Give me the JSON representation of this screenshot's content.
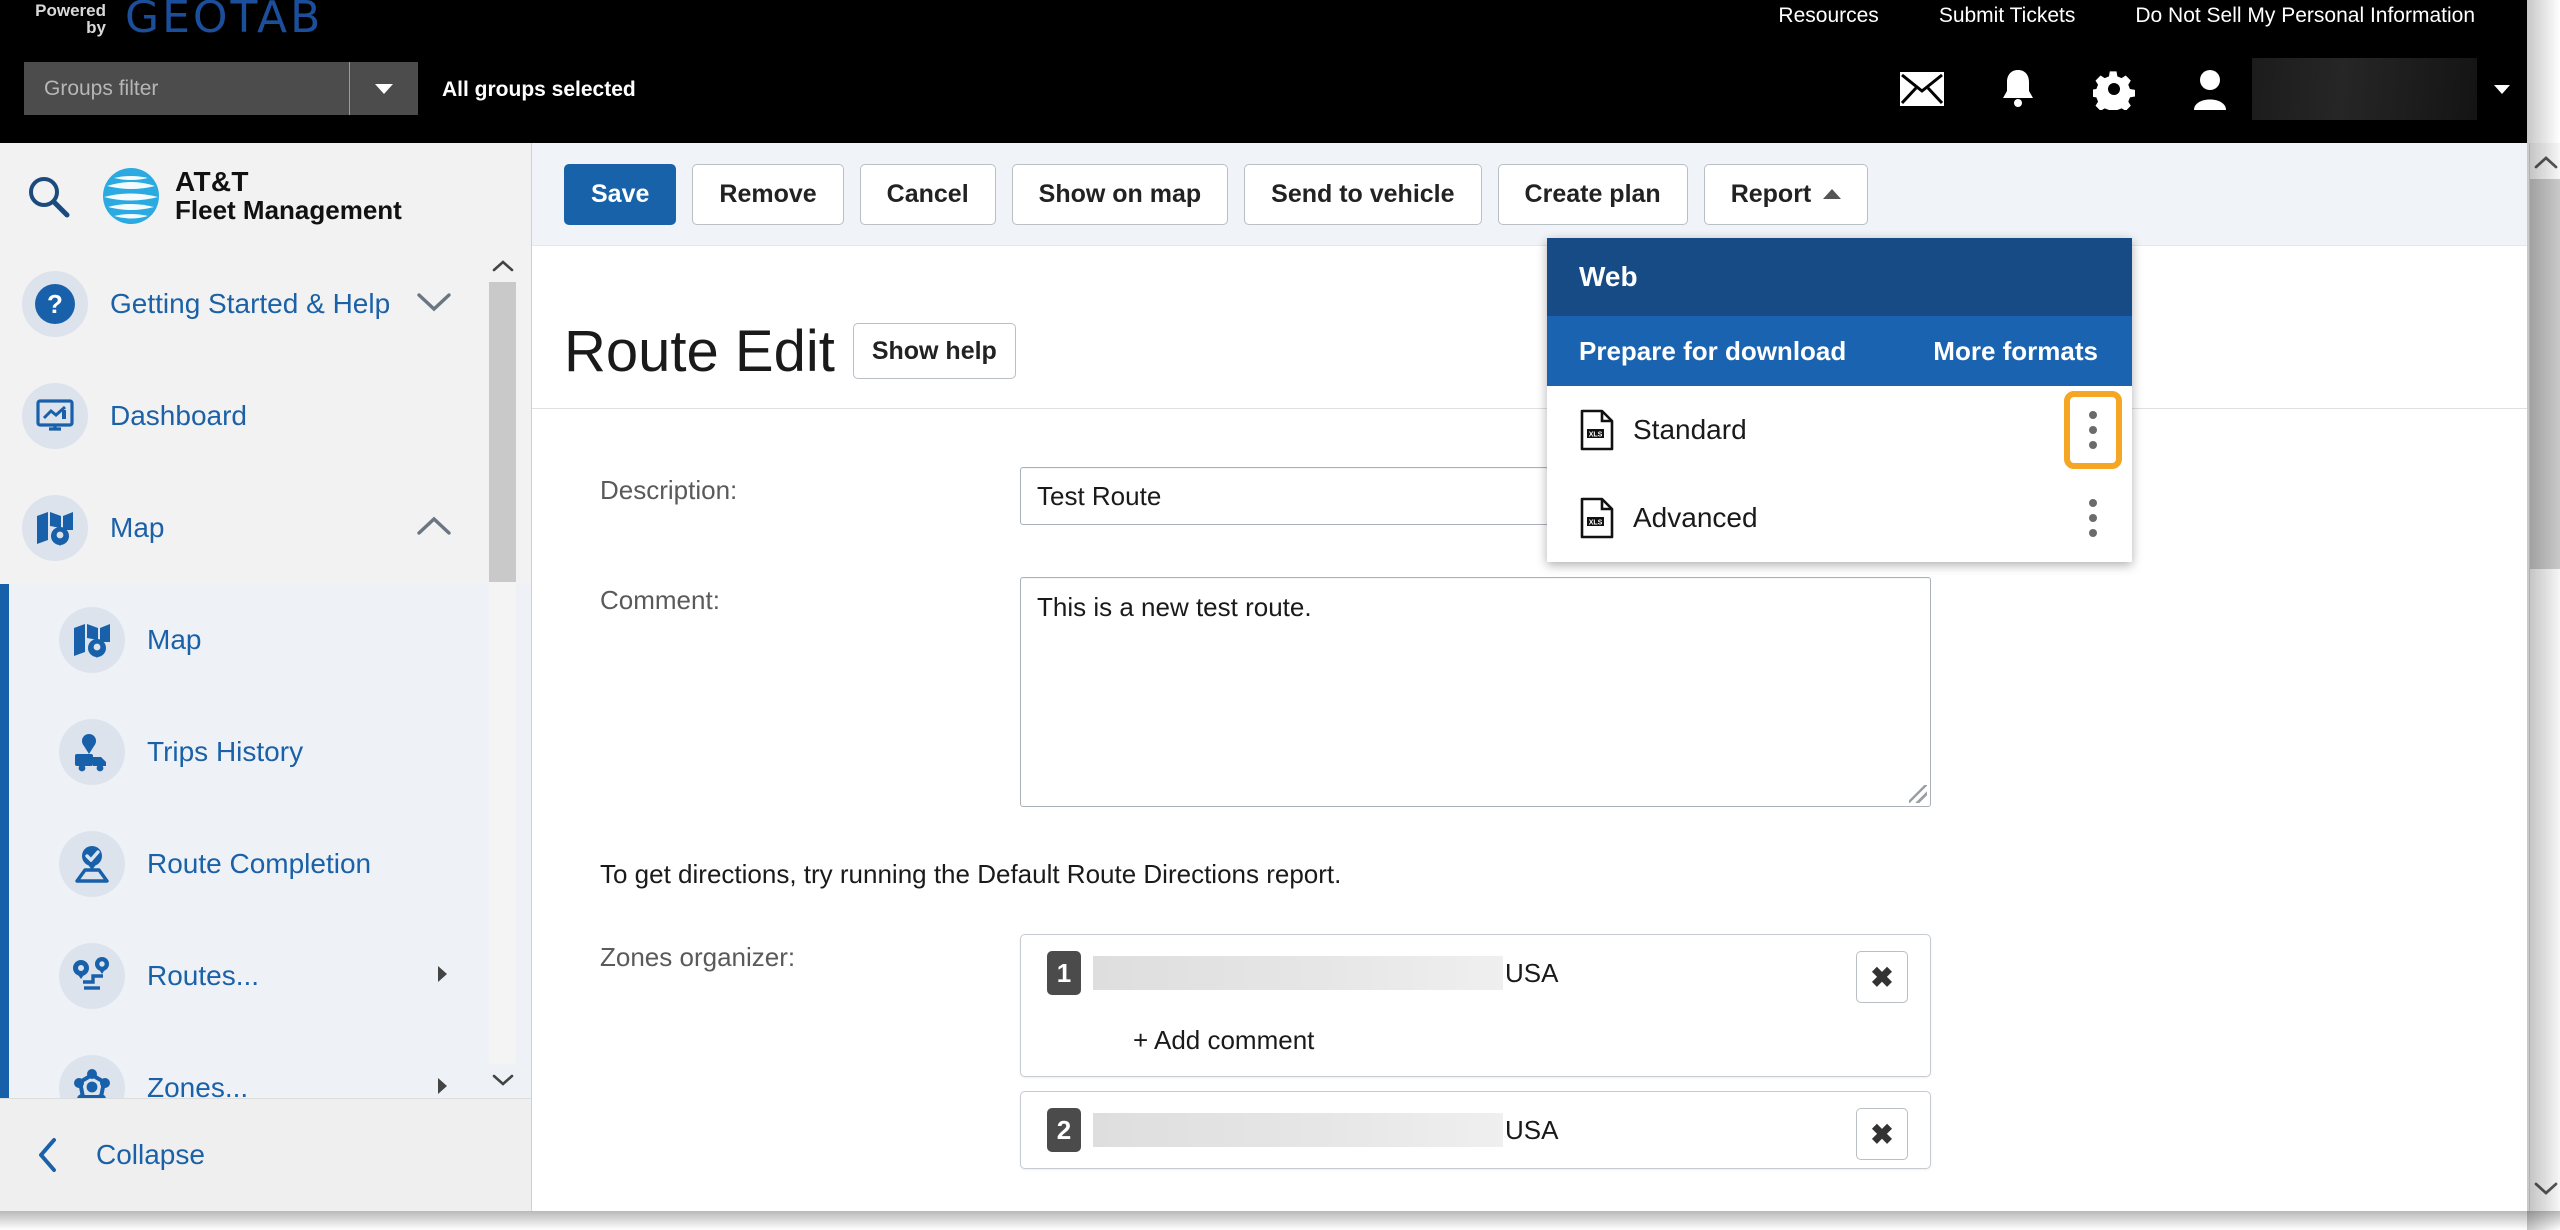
{
  "topbar": {
    "powered_line1": "Powered",
    "powered_line2": "by",
    "brand": "GEOTAB",
    "links": [
      "Resources",
      "Submit Tickets",
      "Do Not Sell My Personal Information"
    ],
    "groups_filter_placeholder": "Groups filter",
    "groups_status": "All groups selected",
    "icons": [
      "mail-icon",
      "bell-icon",
      "gear-icon",
      "user-icon"
    ]
  },
  "sidebar": {
    "search_icon": "search-icon",
    "logo_line1": "AT&T",
    "logo_line2": "Fleet Management",
    "items": [
      {
        "label": "Getting Started & Help",
        "icon": "question-circle-icon",
        "chevron": "chevron-down-icon"
      },
      {
        "label": "Dashboard",
        "icon": "dashboard-icon",
        "chevron": ""
      },
      {
        "label": "Map",
        "icon": "map-pin-icon",
        "chevron": "chevron-up-icon"
      }
    ],
    "sub_items": [
      {
        "label": "Map",
        "icon": "map-pin-icon",
        "chevron": ""
      },
      {
        "label": "Trips History",
        "icon": "trips-history-icon",
        "chevron": ""
      },
      {
        "label": "Route Completion",
        "icon": "route-completion-icon",
        "chevron": ""
      },
      {
        "label": "Routes...",
        "icon": "routes-icon",
        "chevron": "chevron-right-icon"
      },
      {
        "label": "Zones...",
        "icon": "zones-icon",
        "chevron": "chevron-right-icon"
      }
    ],
    "collapse_label": "Collapse"
  },
  "toolbar": {
    "save": "Save",
    "remove": "Remove",
    "cancel": "Cancel",
    "show_on_map": "Show on map",
    "send_to_vehicle": "Send to vehicle",
    "create_plan": "Create plan",
    "report": "Report"
  },
  "page": {
    "title": "Route Edit",
    "show_help": "Show help"
  },
  "form": {
    "description_label": "Description:",
    "description_value": "Test Route",
    "comment_label": "Comment:",
    "comment_value": "This is a new test route.",
    "directions_note": "To get directions, try running the Default Route Directions report.",
    "zones_label": "Zones organizer:",
    "zones": [
      {
        "number": "1",
        "country": "USA",
        "add_comment": "+ Add comment",
        "remove": "✖"
      },
      {
        "number": "2",
        "country": "USA",
        "add_comment": "",
        "remove": "✖"
      }
    ]
  },
  "report_dropdown": {
    "web": "Web",
    "prepare_for_download": "Prepare for download",
    "more_formats": "More formats",
    "items": [
      {
        "label": "Standard",
        "icon": "xls-file-icon",
        "kebab": "kebab-menu-icon",
        "highlighted": true
      },
      {
        "label": "Advanced",
        "icon": "xls-file-icon",
        "kebab": "kebab-menu-icon",
        "highlighted": false
      }
    ]
  },
  "colors": {
    "brand_blue": "#1b4f9c",
    "accent_blue": "#1762a8",
    "menu_header_dark": "#164b85",
    "menu_header_light": "#1a63b0",
    "highlight_orange": "#f5a623",
    "topbar_black": "#000000"
  }
}
